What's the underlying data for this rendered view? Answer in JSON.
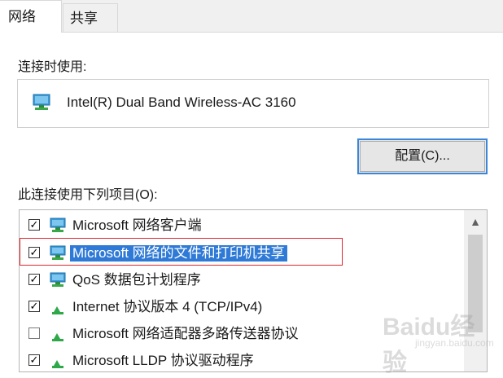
{
  "tabs": [
    {
      "label": "网络",
      "active": true
    },
    {
      "label": "共享",
      "active": false
    }
  ],
  "connect_using_label": "连接时使用:",
  "adapter": {
    "name": "Intel(R) Dual Band Wireless-AC 3160",
    "icon": "network-adapter-icon"
  },
  "configure_button": "配置(C)...",
  "items_label": "此连接使用下列项目(O):",
  "items": [
    {
      "label": "Microsoft 网络客户端",
      "checked": true,
      "icon": "network-client-icon",
      "selected": false
    },
    {
      "label": "Microsoft 网络的文件和打印机共享",
      "checked": true,
      "icon": "network-client-icon",
      "selected": true
    },
    {
      "label": "QoS 数据包计划程序",
      "checked": true,
      "icon": "network-client-icon",
      "selected": false
    },
    {
      "label": "Internet 协议版本 4 (TCP/IPv4)",
      "checked": true,
      "icon": "protocol-icon",
      "selected": false
    },
    {
      "label": "Microsoft 网络适配器多路传送器协议",
      "checked": false,
      "icon": "protocol-icon",
      "selected": false
    },
    {
      "label": "Microsoft LLDP 协议驱动程序",
      "checked": true,
      "icon": "protocol-icon",
      "selected": false
    }
  ],
  "watermark": {
    "brand": "Baidu经验",
    "sub": "jingyan.baidu.com"
  },
  "colors": {
    "selection": "#2f7ad6",
    "highlight_border": "#e0282e",
    "button_focus": "#3a86d8"
  }
}
